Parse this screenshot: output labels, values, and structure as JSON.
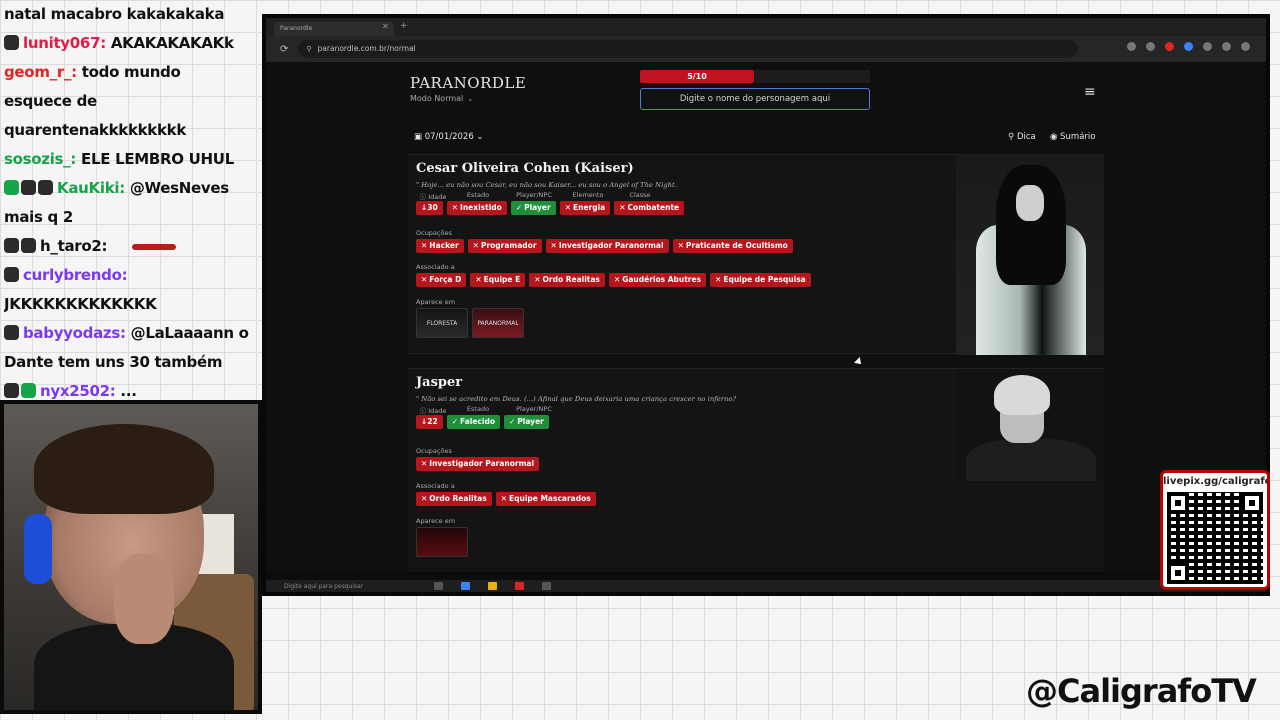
{
  "chat": [
    {
      "user": "",
      "user_color": "#111",
      "badges": [],
      "text": "natal macabro kakakakaka",
      "emote": false
    },
    {
      "user": "lunity067:",
      "user_color": "#e11d48",
      "badges": [
        "dark"
      ],
      "text": "AKAKAKAKAKk",
      "emote": false
    },
    {
      "user": "geom_r_:",
      "user_color": "#dc2626",
      "badges": [],
      "text": "todo mundo",
      "emote": false
    },
    {
      "user": "",
      "user_color": "#111",
      "badges": [],
      "text": "esquece de",
      "emote": false
    },
    {
      "user": "",
      "user_color": "#111",
      "badges": [],
      "text": "quarentenakkkkkkkkk",
      "emote": false
    },
    {
      "user": "sosozis_:",
      "user_color": "#16a34a",
      "badges": [],
      "text": "ELE LEMBRO UHUL",
      "emote": false
    },
    {
      "user": "KauKiki:",
      "user_color": "#16a34a",
      "badges": [
        "green",
        "dark",
        "dark"
      ],
      "text": "@WesNeves",
      "emote": false
    },
    {
      "user": "",
      "user_color": "#111",
      "badges": [],
      "text": "mais q 2",
      "emote": false
    },
    {
      "user": "h_taro2:",
      "user_color": "#111",
      "badges": [
        "dark",
        "dark"
      ],
      "text": "",
      "emote": true
    },
    {
      "user": "curlybrendo:",
      "user_color": "#7c3aed",
      "badges": [
        "dark"
      ],
      "text": "",
      "emote": false
    },
    {
      "user": "",
      "user_color": "#111",
      "badges": [],
      "text": "JKKKKKKKKKKKKK",
      "emote": false
    },
    {
      "user": "babyyodazs:",
      "user_color": "#7c3aed",
      "badges": [
        "dark"
      ],
      "text": "@LaLaaaann o",
      "emote": false
    },
    {
      "user": "",
      "user_color": "#111",
      "badges": [],
      "text": "Dante tem uns 30 também",
      "emote": false
    },
    {
      "user": "nyx2502:",
      "user_color": "#7c3aed",
      "badges": [
        "dark",
        "green"
      ],
      "text": "...",
      "emote": false
    }
  ],
  "browser": {
    "tab_title": "Paranordle",
    "url": "paranordle.com.br/normal"
  },
  "site": {
    "logo": "PARANORDLE",
    "mode": "Modo Normal",
    "progress_label": "5/10",
    "progress_fraction": 0.5,
    "search_placeholder": "Digite o nome do personagem aqui",
    "date": "07/01/2026",
    "hint_label": "Dica",
    "summary_label": "Sumário"
  },
  "labels": {
    "idade": "Idade",
    "estado": "Estado",
    "player_npc": "Player/NPC",
    "elemento": "Elemento",
    "classe": "Classe",
    "ocupacoes": "Ocupações",
    "associado": "Associado a",
    "aparece": "Aparece em"
  },
  "characters": [
    {
      "name": "Cesar Oliveira Cohen (Kaiser)",
      "quote": "\" Hoje... eu não sou Cesar, eu não sou Kaiser... eu sou o Angel of The Night.",
      "attributes": [
        {
          "text": "↓30",
          "status": "red"
        },
        {
          "text": "Inexistido",
          "status": "red"
        },
        {
          "text": "Player",
          "status": "green"
        },
        {
          "text": "Energia",
          "status": "red"
        },
        {
          "text": "Combatente",
          "status": "red"
        }
      ],
      "occupations": [
        "Hacker",
        "Programador",
        "Investigador Paranormal",
        "Praticante de Ocultismo"
      ],
      "associations": [
        "Força D",
        "Equipe E",
        "Ordo Realitas",
        "Gaudérios Abutres",
        "Equipe de Pesquisa"
      ],
      "appears": [
        "FLORESTA",
        "PARANORMAL"
      ]
    },
    {
      "name": "Jasper",
      "quote": "\" Não sei se acredito em Deus. (...) Afinal que Deus deixaria uma criança crescer no inferno?",
      "attributes": [
        {
          "text": "↓22",
          "status": "red"
        },
        {
          "text": "Falecido",
          "status": "green"
        },
        {
          "text": "Player",
          "status": "green"
        }
      ],
      "occupations": [
        "Investigador Paranormal"
      ],
      "associations": [
        "Ordo Realitas",
        "Equipe Mascarados"
      ],
      "appears": [
        ""
      ]
    }
  ],
  "taskbar": {
    "search": "Digite aqui para pesquisar"
  },
  "overlay": {
    "qr_label": "livepix.gg/caligrafo",
    "handle": "@CaligrafoTV"
  },
  "colors": {
    "red_tag": "#b4161b",
    "green_tag": "#1f8f3a",
    "accent_input": "#4a7fd8"
  }
}
